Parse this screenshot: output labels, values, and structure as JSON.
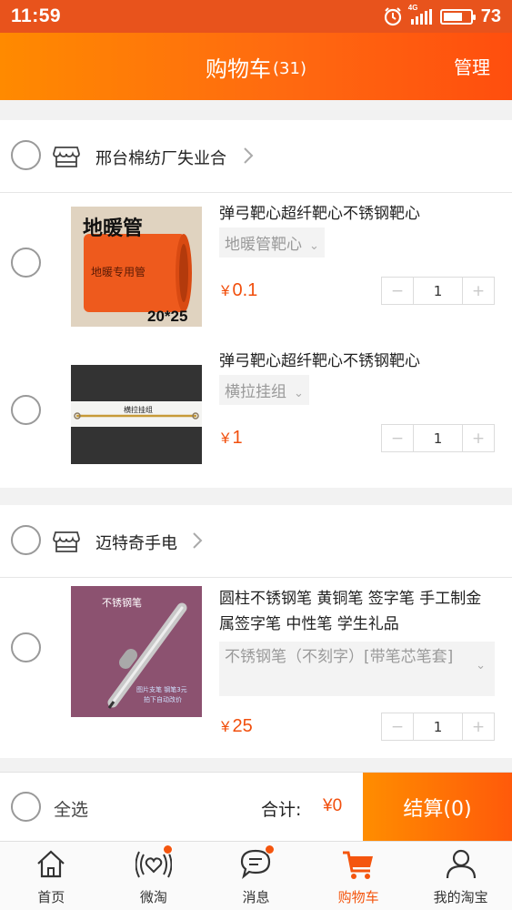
{
  "status_bar": {
    "time": "11:59",
    "network": "4G",
    "battery": "73",
    "battery_level": 0.73
  },
  "header": {
    "title": "购物车",
    "count": "(31)",
    "manage": "管理"
  },
  "icons": {
    "clock": "alarm-clock-icon",
    "signal": "signal-icon",
    "battery": "battery-icon",
    "shop": "store-icon",
    "chevron": "chevron-right-icon"
  },
  "shops": [
    {
      "name": "邢台棉纺厂失业合",
      "items": [
        {
          "title": "弹弓靶心超纤靶心不锈钢靶心",
          "sku": "地暖管靶心",
          "price_symbol": "¥",
          "price": "0.1",
          "qty": "1",
          "image_text": {
            "top": "地暖管",
            "mid": "地暖专用管",
            "bottom": "20*25"
          }
        },
        {
          "title": "弹弓靶心超纤靶心不锈钢靶心",
          "sku": "横拉挂组",
          "price_symbol": "¥",
          "price": "1",
          "qty": "1",
          "image_text": {
            "label": "横拉挂组"
          }
        }
      ]
    },
    {
      "name": "迈特奇手电",
      "items": [
        {
          "title": "圆柱不锈钢笔 黄铜笔  签字笔 手工制金属签字笔 中性笔 学生礼品",
          "sku": "不锈钢笔（不刻字）[带笔芯笔套]",
          "price_symbol": "¥",
          "price": "25",
          "qty": "1",
          "image_text": {
            "label": "不锈钢笔",
            "note1": "图片支笔 钢笔3元",
            "note2": "拍下自动改价"
          }
        }
      ]
    }
  ],
  "stepper": {
    "minus": "−",
    "plus": "+"
  },
  "footer": {
    "select_all": "全选",
    "total_label": "合计:",
    "total_value": "¥0",
    "checkout": "结算(0)"
  },
  "tabs": [
    {
      "label": "首页",
      "icon": "home-icon"
    },
    {
      "label": "微淘",
      "icon": "broadcast-heart-icon"
    },
    {
      "label": "消息",
      "icon": "chat-bubble-icon"
    },
    {
      "label": "购物车",
      "icon": "cart-icon",
      "active": true
    },
    {
      "label": "我的淘宝",
      "icon": "user-icon"
    }
  ],
  "colors": {
    "accent": "#f4550e",
    "status_bar": "#e8531c",
    "header_start": "#ff8a00",
    "header_end": "#ff4e0e",
    "price": "#f14f0d"
  }
}
